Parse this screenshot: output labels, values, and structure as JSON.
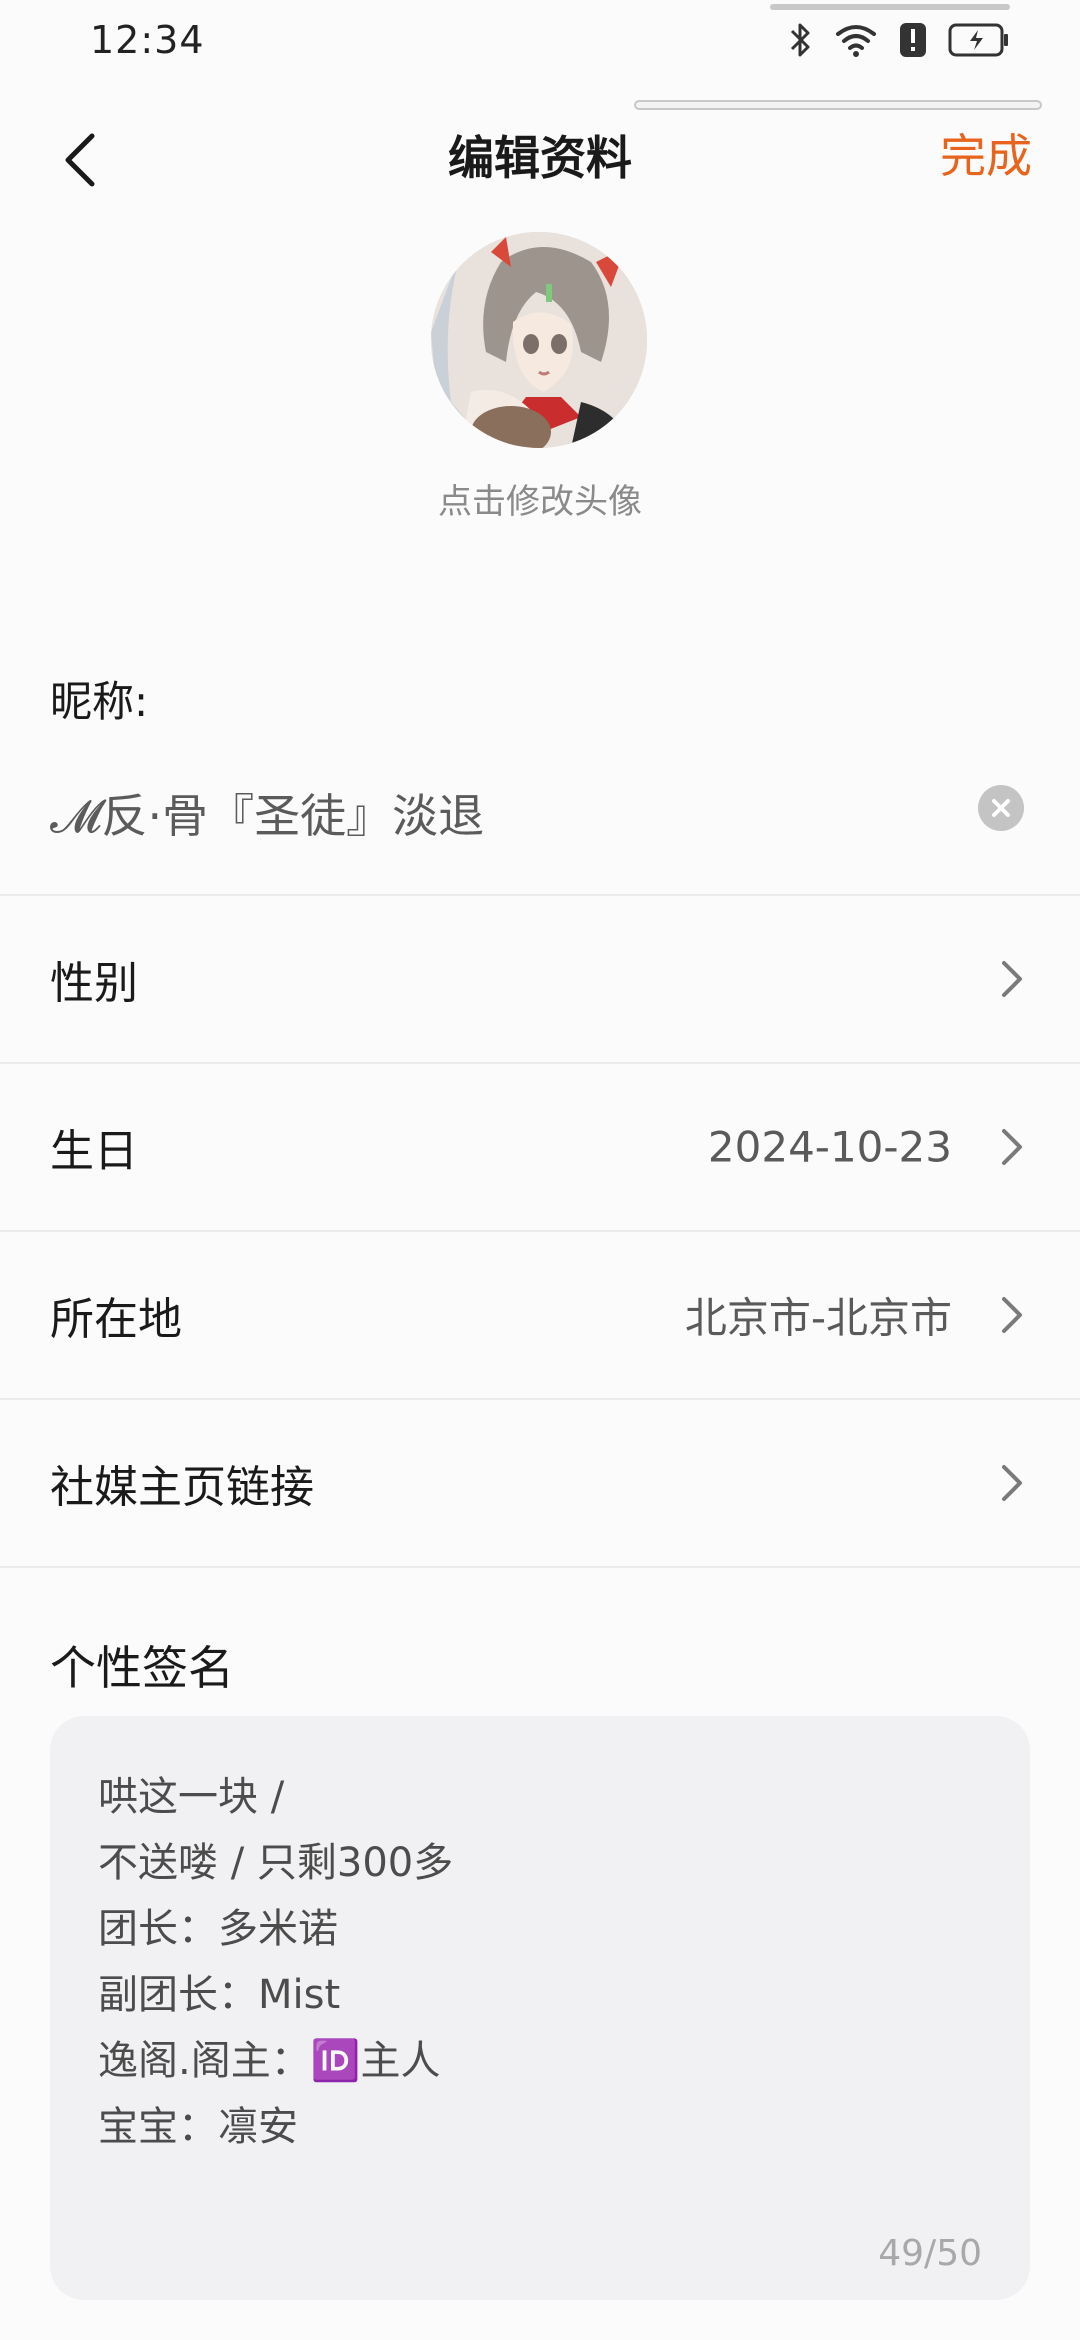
{
  "status_bar": {
    "time": "12:34",
    "icons": [
      "bluetooth-icon",
      "wifi-icon",
      "alert-icon",
      "battery-icon"
    ]
  },
  "header": {
    "title": "编辑资料",
    "back_icon": "chevron-left-icon",
    "done_label": "完成",
    "done_color": "#e8641c"
  },
  "avatar": {
    "hint": "点击修改头像"
  },
  "nickname": {
    "label": "昵称:",
    "value": "𝓜反·骨『圣徒』淡退"
  },
  "rows": {
    "gender": {
      "label": "性别",
      "value": ""
    },
    "birthday": {
      "label": "生日",
      "value": "2024-10-23"
    },
    "location": {
      "label": "所在地",
      "value": "北京市-北京市"
    },
    "social": {
      "label": "社媒主页链接",
      "value": ""
    }
  },
  "signature": {
    "title": "个性签名",
    "lines": [
      "哄这一块 /",
      "不送喽 / 只剩300多",
      "团长：多米诺",
      "副团长：Mist",
      "逸阁.阁主：🆔主人",
      "宝宝：凛安"
    ],
    "count": "49/50"
  }
}
